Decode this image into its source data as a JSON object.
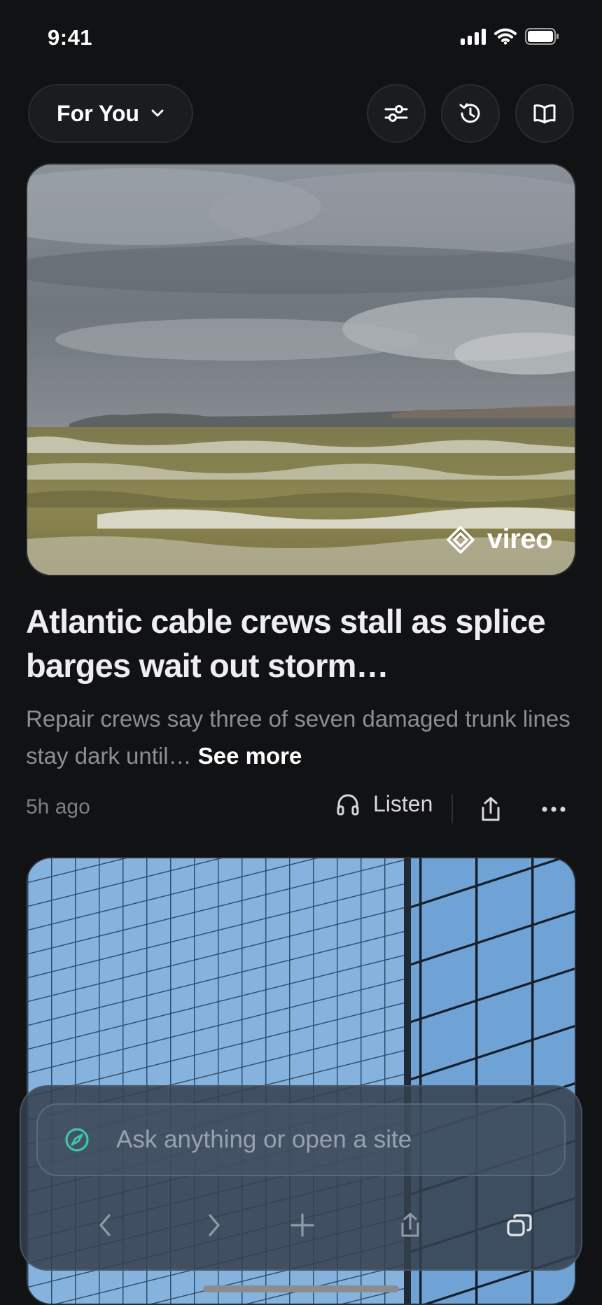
{
  "status_bar": {
    "time": "9:41"
  },
  "top_bar": {
    "feed_label": "For You"
  },
  "story_1": {
    "source_brand": "vireo",
    "headline": "Atlantic cable crews stall as splice barges wait out storm…",
    "summary": "Repair crews say three of seven damaged trunk lines stay dark until…",
    "see_more": "See more",
    "time_ago": "5h ago",
    "listen_label": "Listen"
  },
  "bottom_bar": {
    "search_placeholder": "Ask anything or open a site"
  },
  "colors": {
    "background": "#111214",
    "accent_teal": "#3ec7a7",
    "summary_text": "#8d8e93"
  },
  "icons": {
    "filter": "sliders-icon",
    "history": "history-icon",
    "reader": "book-open-icon",
    "listen": "headphones-icon",
    "share": "share-icon",
    "more": "more-icon",
    "back": "chevron-left-icon",
    "forward": "chevron-right-icon",
    "new_tab": "plus-icon",
    "tabs": "tabs-icon"
  }
}
